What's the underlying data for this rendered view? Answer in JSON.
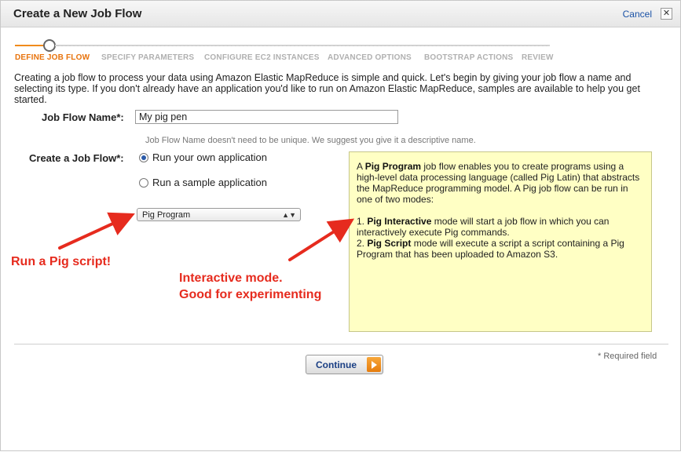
{
  "dialog": {
    "title": "Create a New Job Flow",
    "cancel_label": "Cancel",
    "close_glyph": "✕"
  },
  "wizard": {
    "steps": [
      {
        "label": "DEFINE JOB FLOW",
        "active": true
      },
      {
        "label": "SPECIFY PARAMETERS",
        "active": false
      },
      {
        "label": "CONFIGURE EC2 INSTANCES",
        "active": false
      },
      {
        "label": "ADVANCED OPTIONS",
        "active": false
      },
      {
        "label": "BOOTSTRAP ACTIONS",
        "active": false
      },
      {
        "label": "REVIEW",
        "active": false
      }
    ]
  },
  "intro": "Creating a job flow to process your data using Amazon Elastic MapReduce is simple and quick. Let's begin by giving your job flow a name and selecting its type. If you don't already have an application you'd like to run on Amazon Elastic MapReduce, samples are available to help you get started.",
  "form": {
    "name_label": "Job Flow Name*:",
    "name_value": "My pig pen",
    "name_hint": "Job Flow Name doesn't need to be unique. We suggest you give it a descriptive name.",
    "create_label": "Create a Job Flow*:",
    "radio_own": "Run your own application",
    "radio_sample": "Run a sample application",
    "selected_radio": "own",
    "app_type_selected": "Pig Program"
  },
  "info": {
    "p1_bold": "Pig Program",
    "p1_rest": " job flow enables you to create programs using a high-level data processing language (called Pig Latin) that abstracts the MapReduce programming model. A Pig job flow can be run in one of two modes:",
    "m1_num": "1. ",
    "m1_bold": "Pig Interactive",
    "m1_rest": " mode will start a job flow in which you can interactively execute Pig commands.",
    "m2_num": "2. ",
    "m2_bold": "Pig Script",
    "m2_rest": " mode will execute a script a script containing a Pig Program that has been uploaded to Amazon S3."
  },
  "annotations": {
    "left": "Run a Pig script!",
    "right_line1": "Interactive mode.",
    "right_line2": "Good for experimenting",
    "color": "#e62b1e"
  },
  "footer": {
    "required_note": "* Required field",
    "continue_label": "Continue"
  },
  "colors": {
    "accent": "#e8730c",
    "link": "#1a52a6",
    "info_bg": "#ffffc4"
  }
}
